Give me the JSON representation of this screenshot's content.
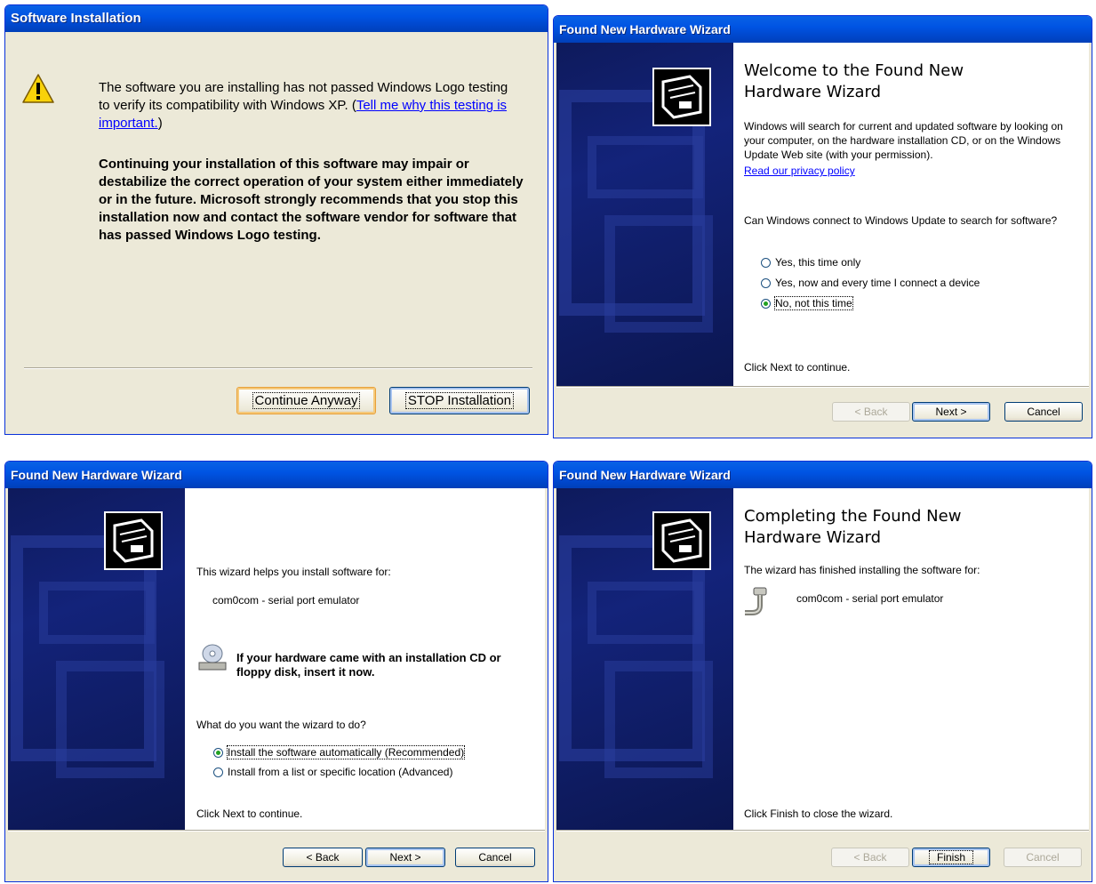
{
  "install_dialog": {
    "title": "Software Installation",
    "message_part1": "The software you are installing has not passed Windows Logo testing to verify its compatibility with Windows XP. (",
    "link": "Tell me why this testing is important.",
    "message_part2": ")",
    "warning": "Continuing your installation of this software may impair or destabilize the correct operation of your system either immediately or in the future. Microsoft strongly recommends that you stop this installation now and contact the software vendor for software that has passed Windows Logo testing.",
    "continue_button": "Continue Anyway",
    "stop_button": "STOP Installation",
    "icon": "warning-icon"
  },
  "welcome_wizard": {
    "title": "Found New Hardware Wizard",
    "heading": "Welcome to the Found New Hardware Wizard",
    "intro": "Windows will search for current and updated software by looking on your computer, on the hardware installation CD, or on the Windows Update Web site (with your permission).",
    "privacy_link": "Read our privacy policy",
    "question": "Can Windows connect to Windows Update to search for software?",
    "options": [
      {
        "label": "Yes, this time only",
        "selected": false
      },
      {
        "label": "Yes, now and every time I connect a device",
        "selected": false
      },
      {
        "label": "No, not this time",
        "selected": true
      }
    ],
    "footer": "Click Next to continue.",
    "back_button": "< Back",
    "next_button": "Next >",
    "cancel_button": "Cancel"
  },
  "install_wizard": {
    "title": "Found New Hardware Wizard",
    "intro": "This wizard helps you install software for:",
    "device": "com0com - serial port emulator",
    "cd_hint": "If your hardware came with an installation CD or floppy disk, insert it now.",
    "question": "What do you want the wizard to do?",
    "options": [
      {
        "label": "Install the software automatically (Recommended)",
        "selected": true
      },
      {
        "label": "Install from a list or specific location (Advanced)",
        "selected": false
      }
    ],
    "footer": "Click Next to continue.",
    "back_button": "< Back",
    "next_button": "Next >",
    "cancel_button": "Cancel"
  },
  "complete_wizard": {
    "title": "Found New Hardware Wizard",
    "heading": "Completing the Found New Hardware Wizard",
    "intro": "The wizard has finished installing the software for:",
    "device": "com0com - serial port emulator",
    "footer": "Click Finish to close the wizard.",
    "back_button": "< Back",
    "finish_button": "Finish",
    "cancel_button": "Cancel"
  },
  "colors": {
    "title_bar": "#0054e3",
    "dialog_face": "#ece9d8",
    "wizard_side": "#13237a",
    "link": "#0000ff"
  }
}
